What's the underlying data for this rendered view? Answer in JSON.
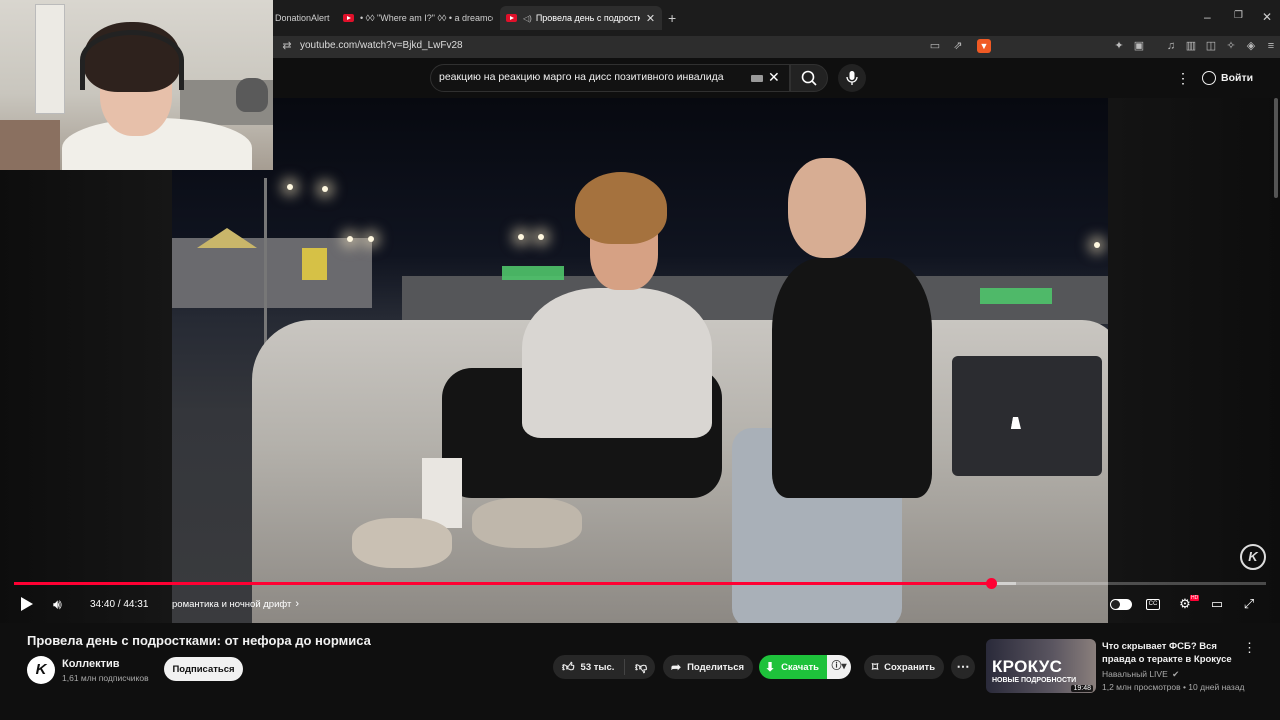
{
  "browser": {
    "tabs": [
      {
        "label": "DonationAlert"
      },
      {
        "label": "• ◊◊ \"Where am I?\" ◊◊ • a dreamco"
      },
      {
        "label": "Провела день с подростками"
      }
    ],
    "url": "youtube.com/watch?v=Bjkd_LwFv28"
  },
  "youtube": {
    "search_query": "реакцию на реакцию марго на дисс позитивного инвалида",
    "signin_label": "Войти"
  },
  "player": {
    "time": "34:40 / 44:31",
    "chapter": "романтика и ночной дрифт",
    "progress": 0.78,
    "buffered": 0.8,
    "watermark": "K",
    "colors": {
      "progress": "#ff0033",
      "download": "#1ec23b"
    }
  },
  "video": {
    "title": "Провела день с подростками: от нефора до нормиса",
    "channel_name": "Коллектив",
    "channel_subs": "1,61 млн подписчиков",
    "channel_avatar_letter": "K",
    "subscribe_label": "Подписаться",
    "likes": "53 тыс.",
    "share_label": "Поделиться",
    "download_label": "Скачать",
    "save_label": "Сохранить"
  },
  "recommended": {
    "thumb_title": "КРОКУС",
    "thumb_subtitle": "НОВЫЕ ПОДРОБНОСТИ",
    "duration": "19:48",
    "title": "Что скрывает ФСБ? Вся правда о теракте в Крокусе",
    "channel": "Навальный LIVE",
    "meta": "1,2 млн просмотров • 10 дней назад"
  }
}
